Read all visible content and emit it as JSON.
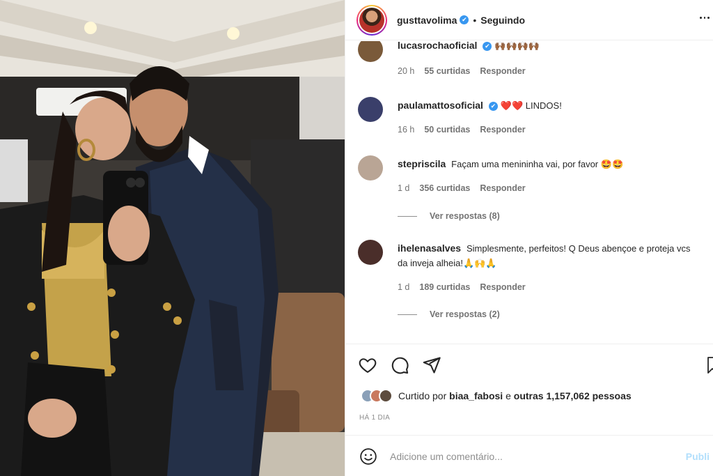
{
  "header": {
    "username": "gusttavolima",
    "verified_glyph": "✔",
    "separator": "•",
    "follow_status": "Seguindo"
  },
  "comments": [
    {
      "username": "lucasrochaoficial",
      "verified": true,
      "text": "🙌🏾🙌🏾🙌🏾🙌🏾",
      "time": "20 h",
      "likes": "55 curtidas",
      "reply": "Responder",
      "avatar_color": "#7a5a3a"
    },
    {
      "username": "paulamattosoficial",
      "verified": true,
      "text": "❤️❤️ LINDOS!",
      "time": "16 h",
      "likes": "50 curtidas",
      "reply": "Responder",
      "avatar_color": "#3a3f6a"
    },
    {
      "username": "stepriscila",
      "verified": false,
      "text": "Façam uma menininha vai, por favor 🤩🤩",
      "time": "1 d",
      "likes": "356 curtidas",
      "reply": "Responder",
      "view_replies": "Ver respostas (8)",
      "avatar_color": "#b9a595"
    },
    {
      "username": "ihelenasalves",
      "verified": false,
      "text": "Simplesmente, perfeitos! Q Deus abençoe e proteja vcs da inveja alheia!🙏🙌🙏",
      "time": "1 d",
      "likes": "189 curtidas",
      "reply": "Responder",
      "view_replies": "Ver respostas (2)",
      "avatar_color": "#4a2e2a"
    }
  ],
  "actions": {
    "like_icon": "heart-icon",
    "comment_icon": "comment-icon",
    "share_icon": "share-icon",
    "save_icon": "bookmark-icon"
  },
  "likes_summary": {
    "prefix": "Curtido por",
    "user": "biaa_fabosi",
    "middle": "e",
    "others": "outras 1,157,062 pessoas"
  },
  "timestamp": "HÁ 1 DIA",
  "add_comment": {
    "placeholder": "Adicione um comentário...",
    "publish_label": "Publi"
  },
  "colors": {
    "verified": "#3897f0",
    "muted_text": "#737373",
    "publish_disabled": "#b2dffc"
  }
}
